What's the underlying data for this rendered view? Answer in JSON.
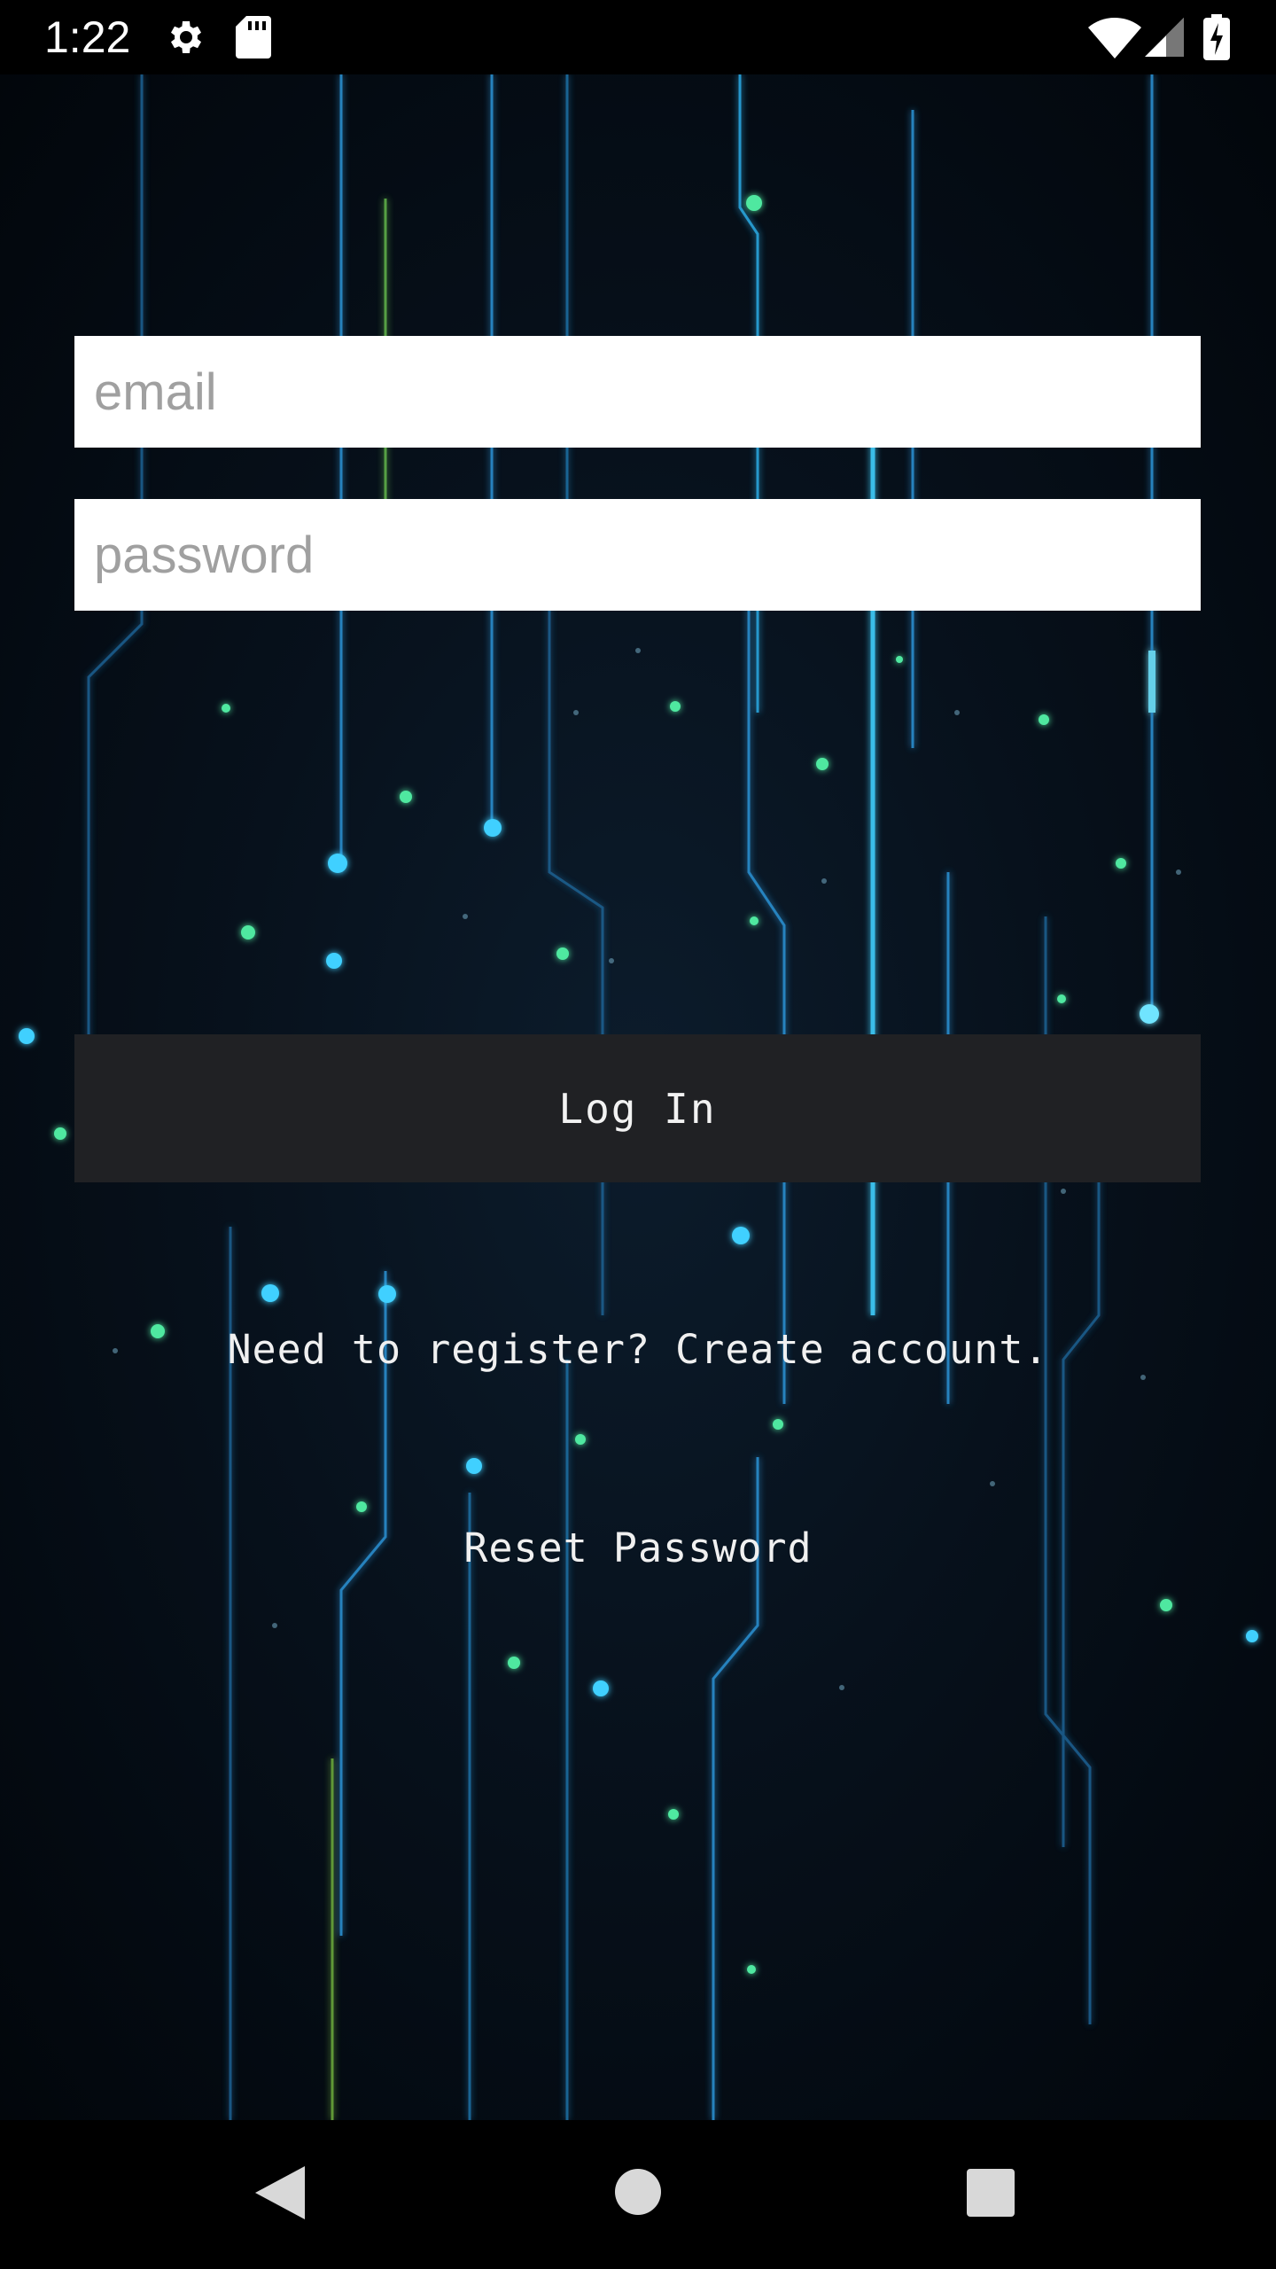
{
  "status_bar": {
    "time": "1:22",
    "left_icons": [
      "settings-icon",
      "sd-card-icon"
    ],
    "right_icons": [
      "wifi-icon",
      "cell-signal-icon",
      "battery-charging-icon"
    ]
  },
  "login_form": {
    "email_placeholder": "email",
    "email_value": "",
    "password_placeholder": "password",
    "password_value": "",
    "login_label": "Log In",
    "register_link": "Need to register? Create account.",
    "reset_link": "Reset Password"
  },
  "nav_bar": {
    "icons": [
      "back-icon",
      "home-icon",
      "recents-icon"
    ]
  },
  "colors": {
    "background": "#07111c",
    "button_bg": "#202124",
    "text_light": "#f0f0f0",
    "placeholder": "#a0a0a0",
    "accent_cyan": "#3fd0ff",
    "accent_green": "#4fe8a0"
  }
}
